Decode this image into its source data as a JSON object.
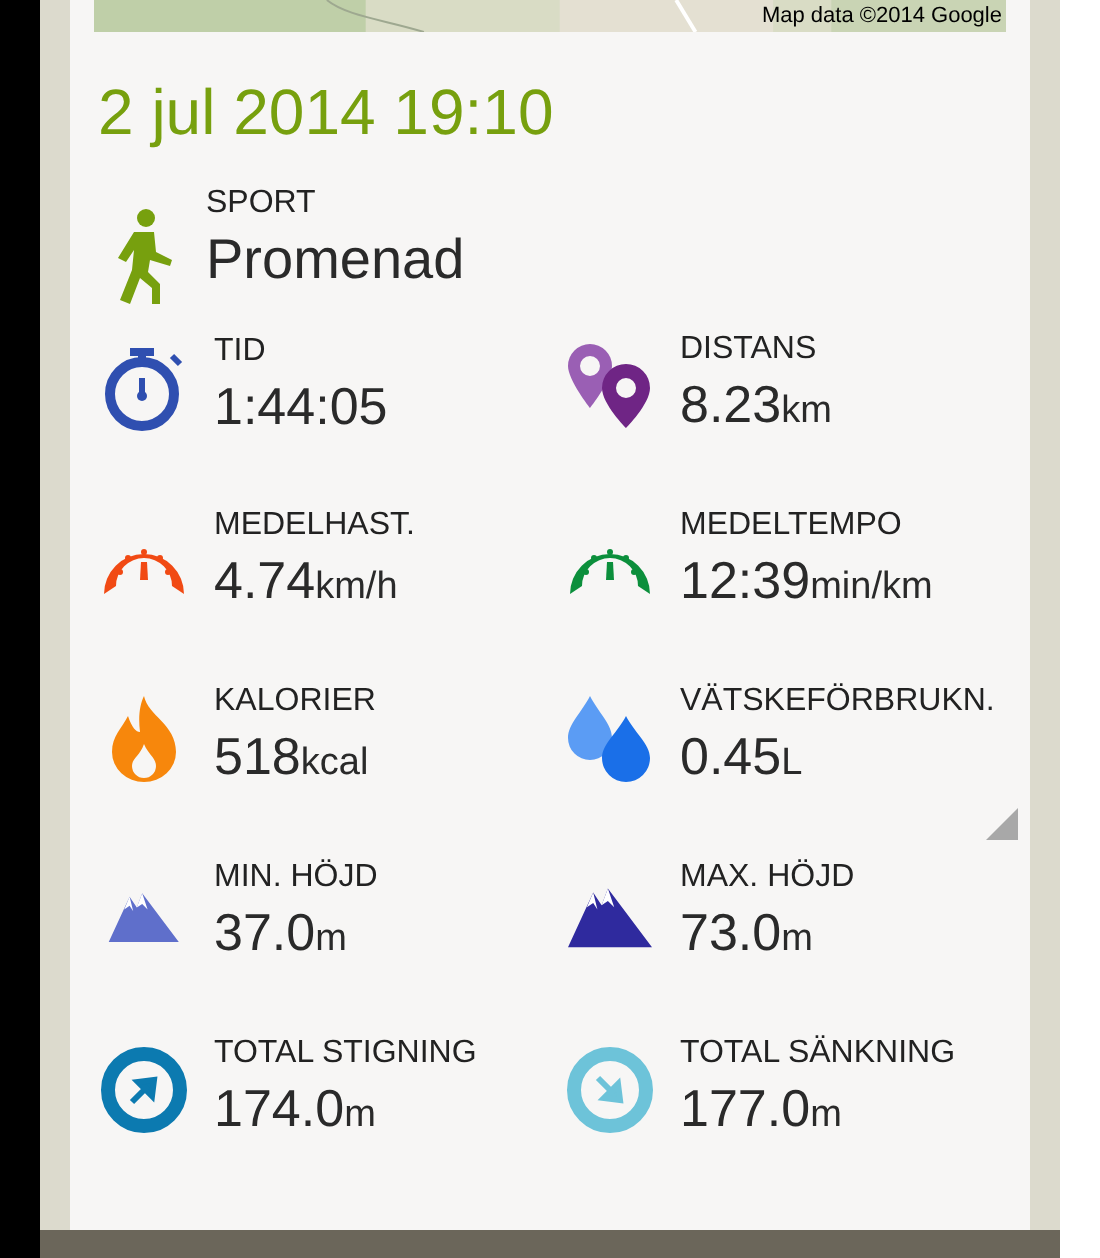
{
  "map": {
    "attribution": "Map data ©2014 Google"
  },
  "date": "2 jul 2014 19:10",
  "sport": {
    "label": "SPORT",
    "value": "Promenad"
  },
  "stats": [
    {
      "kind": "stopwatch",
      "label": "TID",
      "value": "1:44:05"
    },
    {
      "kind": "pins",
      "label": "DISTANS",
      "value": "8.23",
      "unit": "km"
    },
    {
      "kind": "speed",
      "label": "MEDELHAST.",
      "value": "4.74",
      "unit": "km/h"
    },
    {
      "kind": "pace",
      "label": "MEDELTEMPO",
      "value": "12:39",
      "unit": "min/km"
    },
    {
      "kind": "flame",
      "label": "KALORIER",
      "value": "518",
      "unit": "kcal"
    },
    {
      "kind": "drops",
      "label": "VÄTSKEFÖRBRUKN.",
      "value": "0.45",
      "unit": "L"
    },
    {
      "kind": "min-altitude",
      "label": "MIN. HÖJD",
      "value": "37.0",
      "unit": "m"
    },
    {
      "kind": "max-altitude",
      "label": "MAX. HÖJD",
      "value": "73.0",
      "unit": "m"
    },
    {
      "kind": "ascent",
      "label": "TOTAL STIGNING",
      "value": "174.0",
      "unit": "m"
    },
    {
      "kind": "descent",
      "label": "TOTAL SÄNKNING",
      "value": "177.0",
      "unit": "m"
    }
  ]
}
